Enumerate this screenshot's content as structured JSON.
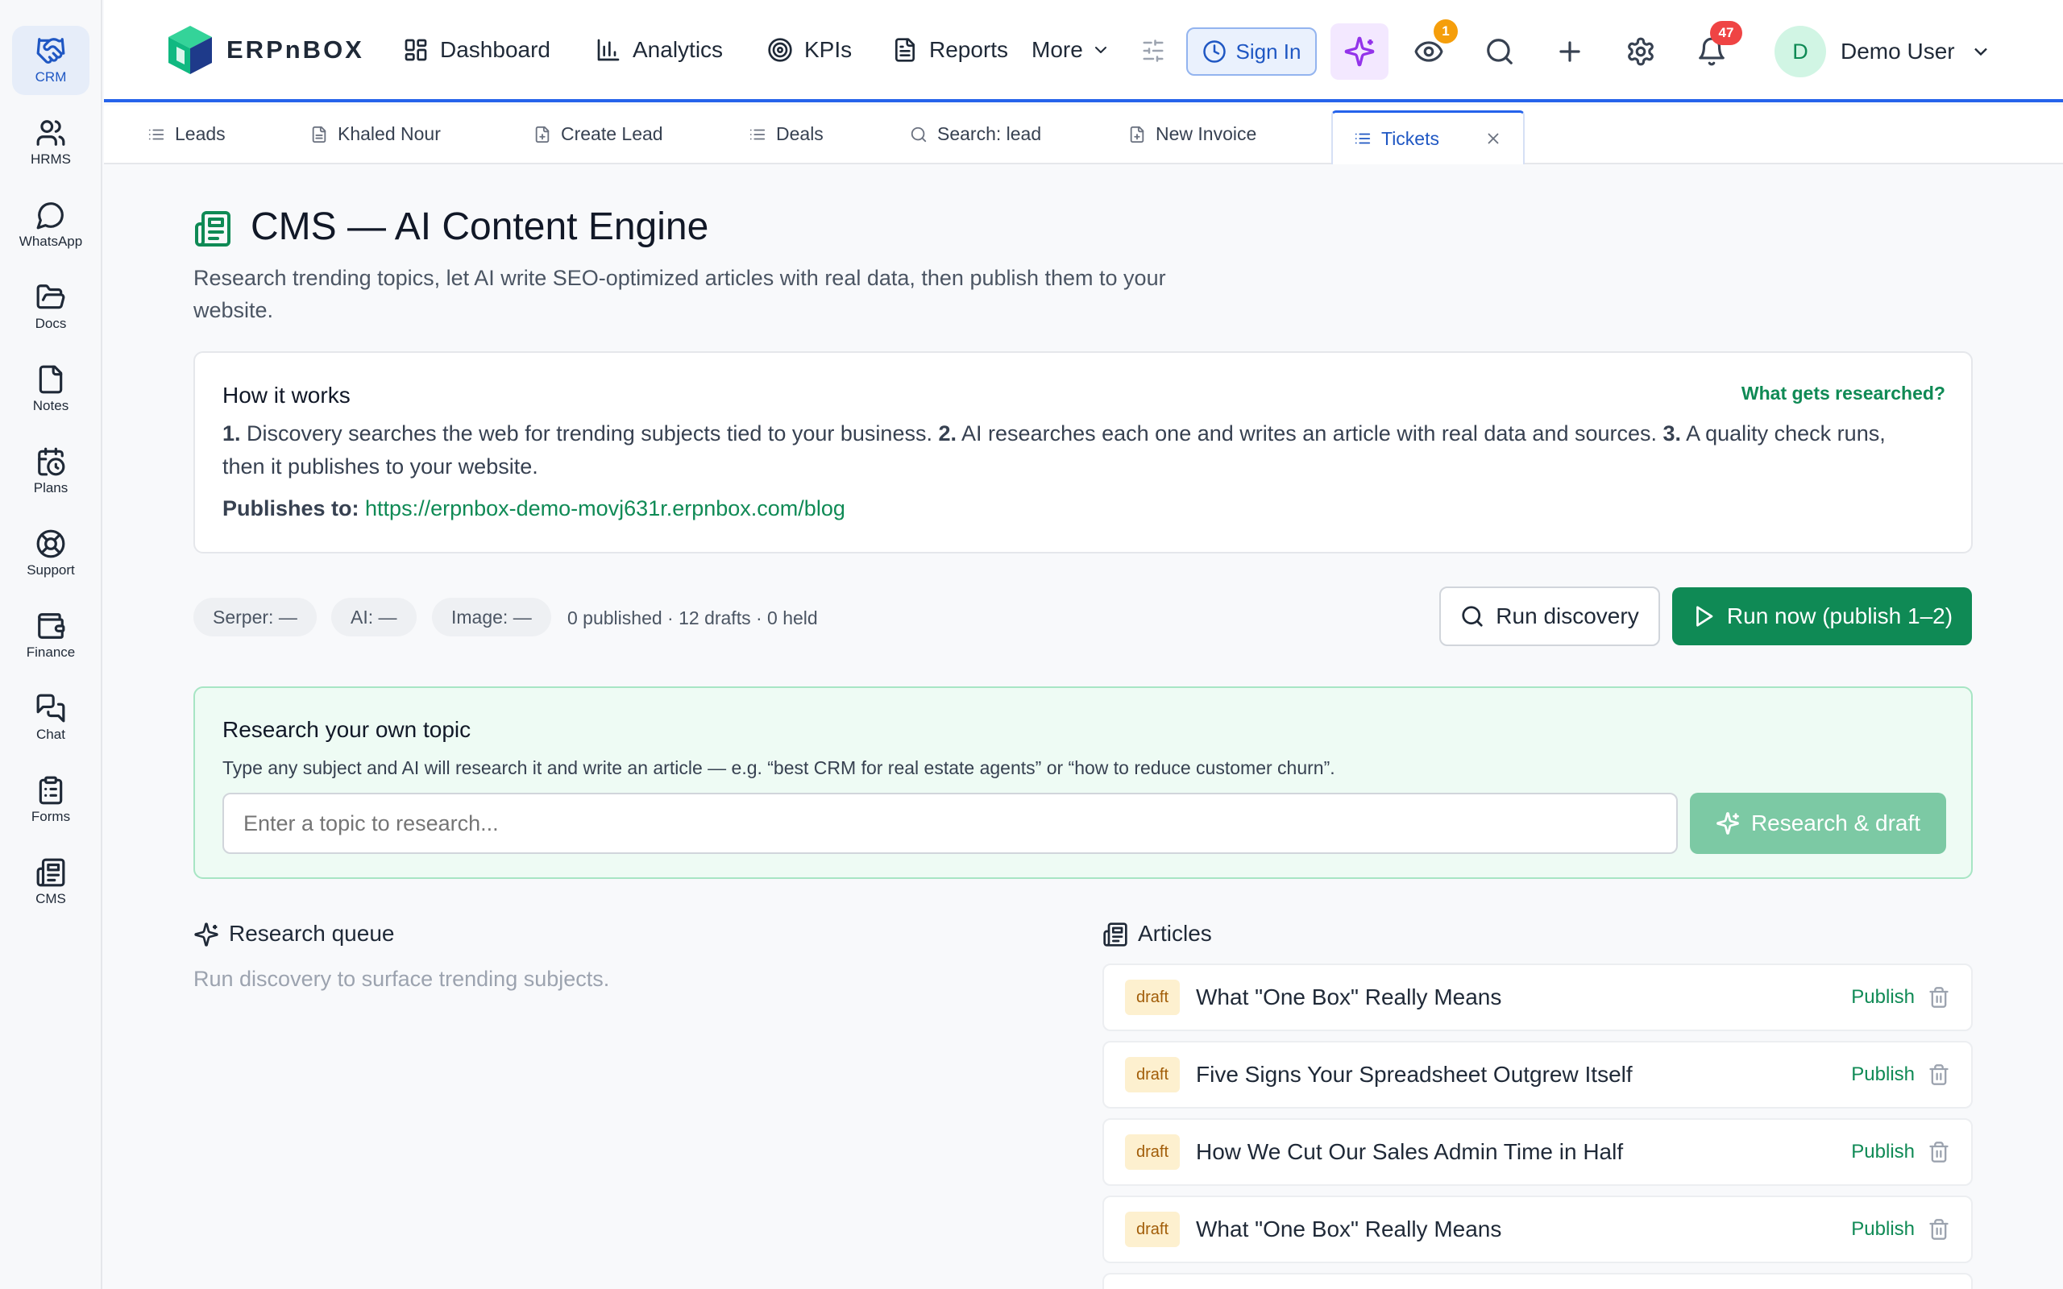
{
  "colors": {
    "accent": "#2563eb",
    "brand_green": "#0f8a55",
    "draft_bg": "#fdf0cf",
    "bell_badge": "#ef4444",
    "eye_badge": "#f59e0b"
  },
  "rail": [
    {
      "label": "CRM",
      "icon": "handshake-icon"
    },
    {
      "label": "HRMS",
      "icon": "users-icon"
    },
    {
      "label": "WhatsApp",
      "icon": "chat-bubble-icon"
    },
    {
      "label": "Docs",
      "icon": "folder-icon"
    },
    {
      "label": "Notes",
      "icon": "file-icon"
    },
    {
      "label": "Plans",
      "icon": "calendar-clock-icon"
    },
    {
      "label": "Support",
      "icon": "lifebuoy-icon"
    },
    {
      "label": "Finance",
      "icon": "wallet-icon"
    },
    {
      "label": "Chat",
      "icon": "messages-icon"
    },
    {
      "label": "Forms",
      "icon": "clipboard-icon"
    },
    {
      "label": "CMS",
      "icon": "newspaper-icon"
    }
  ],
  "brand": {
    "name": "ERPnBOX"
  },
  "nav": {
    "dashboard": "Dashboard",
    "analytics": "Analytics",
    "kpis": "KPIs",
    "reports": "Reports",
    "more": "More",
    "sign_in": "Sign In",
    "eye_badge": "1",
    "bell_badge": "47",
    "user_initial": "D",
    "user_name": "Demo User"
  },
  "tabs": [
    {
      "label": "Leads",
      "icon": "list-icon"
    },
    {
      "label": "Khaled Nour",
      "icon": "document-icon"
    },
    {
      "label": "Create Lead",
      "icon": "document-plus-icon"
    },
    {
      "label": "Deals",
      "icon": "list-icon"
    },
    {
      "label": "Search: lead",
      "icon": "search-icon"
    },
    {
      "label": "New Invoice",
      "icon": "document-plus-icon"
    },
    {
      "label": "Tickets",
      "icon": "list-icon",
      "active": true
    }
  ],
  "page": {
    "title": "CMS — AI Content Engine",
    "subtitle": "Research trending topics, let AI write SEO-optimized articles with real data, then publish them to your website."
  },
  "how": {
    "title": "How it works",
    "link": "What gets researched?",
    "step1_num": "1.",
    "step1": "Discovery searches the web for trending subjects tied to your business.",
    "step2_num": "2.",
    "step2": "AI researches each one and writes an article with real data and sources.",
    "step3_num": "3.",
    "step3": "A quality check runs, then it publishes to your website.",
    "publishes_label": "Publishes to:",
    "publishes_url": "https://erpnbox-demo-movj631r.erpnbox.com/blog"
  },
  "status": {
    "serper": "Serper: —",
    "ai": "AI: —",
    "image": "Image: —",
    "counts": "0 published · 12 drafts · 0 held"
  },
  "actions": {
    "run_discovery": "Run discovery",
    "run_now": "Run now (publish 1–2)"
  },
  "research": {
    "title": "Research your own topic",
    "description": "Type any subject and AI will research it and write an article — e.g. “best CRM for real estate agents” or “how to reduce customer churn”.",
    "placeholder": "Enter a topic to research...",
    "button": "Research & draft"
  },
  "queue": {
    "title": "Research queue",
    "empty": "Run discovery to surface trending subjects."
  },
  "articles": {
    "title": "Articles",
    "publish_label": "Publish",
    "items": [
      {
        "status": "draft",
        "title": "What \"One Box\" Really Means"
      },
      {
        "status": "draft",
        "title": "Five Signs Your Spreadsheet Outgrew Itself"
      },
      {
        "status": "draft",
        "title": "How We Cut Our Sales Admin Time in Half"
      },
      {
        "status": "draft",
        "title": "What \"One Box\" Really Means"
      }
    ]
  }
}
